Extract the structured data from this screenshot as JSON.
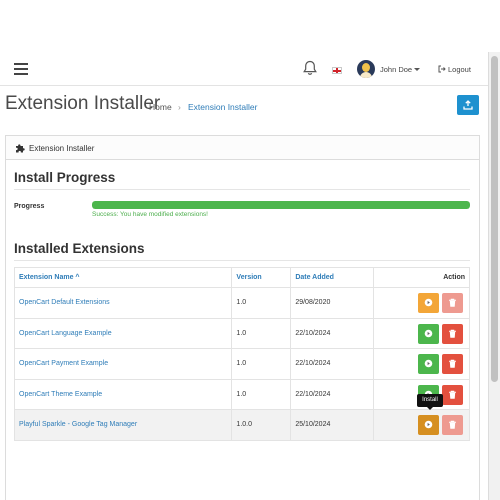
{
  "header": {
    "user_name": "John Doe",
    "logout_label": "Logout",
    "icons": [
      "menu-icon",
      "bell-icon",
      "flag-icon",
      "avatar",
      "chevron-down-icon",
      "logout-icon"
    ]
  },
  "page": {
    "title": "Extension Installer",
    "breadcrumb": [
      {
        "label": "Home"
      },
      {
        "label": "Extension Installer"
      }
    ]
  },
  "panel": {
    "heading": "Extension Installer"
  },
  "install_progress": {
    "title": "Install Progress",
    "label": "Progress",
    "value": 1.0,
    "bar_color": "#4cb64c",
    "message": "Success: You have modified extensions!"
  },
  "installed": {
    "title": "Installed Extensions",
    "columns": {
      "name": "Extension Name ^",
      "version": "Version",
      "date": "Date Added",
      "action": "Action"
    },
    "rows": [
      {
        "name": "OpenCart Default Extensions",
        "version": "1.0",
        "date": "29/08/2020",
        "primary": "orange",
        "delete": "faded"
      },
      {
        "name": "OpenCart Language Example",
        "version": "1.0",
        "date": "22/10/2024",
        "primary": "green",
        "delete": "red"
      },
      {
        "name": "OpenCart Payment Example",
        "version": "1.0",
        "date": "22/10/2024",
        "primary": "green",
        "delete": "red"
      },
      {
        "name": "OpenCart Theme Example",
        "version": "1.0",
        "date": "22/10/2024",
        "primary": "green",
        "delete": "red"
      },
      {
        "name": "Playful Sparkle - Google Tag Manager",
        "version": "1.0.0",
        "date": "25/10/2024",
        "primary": "orange-dark",
        "delete": "faded"
      }
    ],
    "tooltip": "Install"
  },
  "colors": {
    "link": "#2f7db8",
    "primary_blue": "#1e91cf",
    "green": "#4cb64c",
    "orange": "#f3a638",
    "red": "#e3503e"
  }
}
